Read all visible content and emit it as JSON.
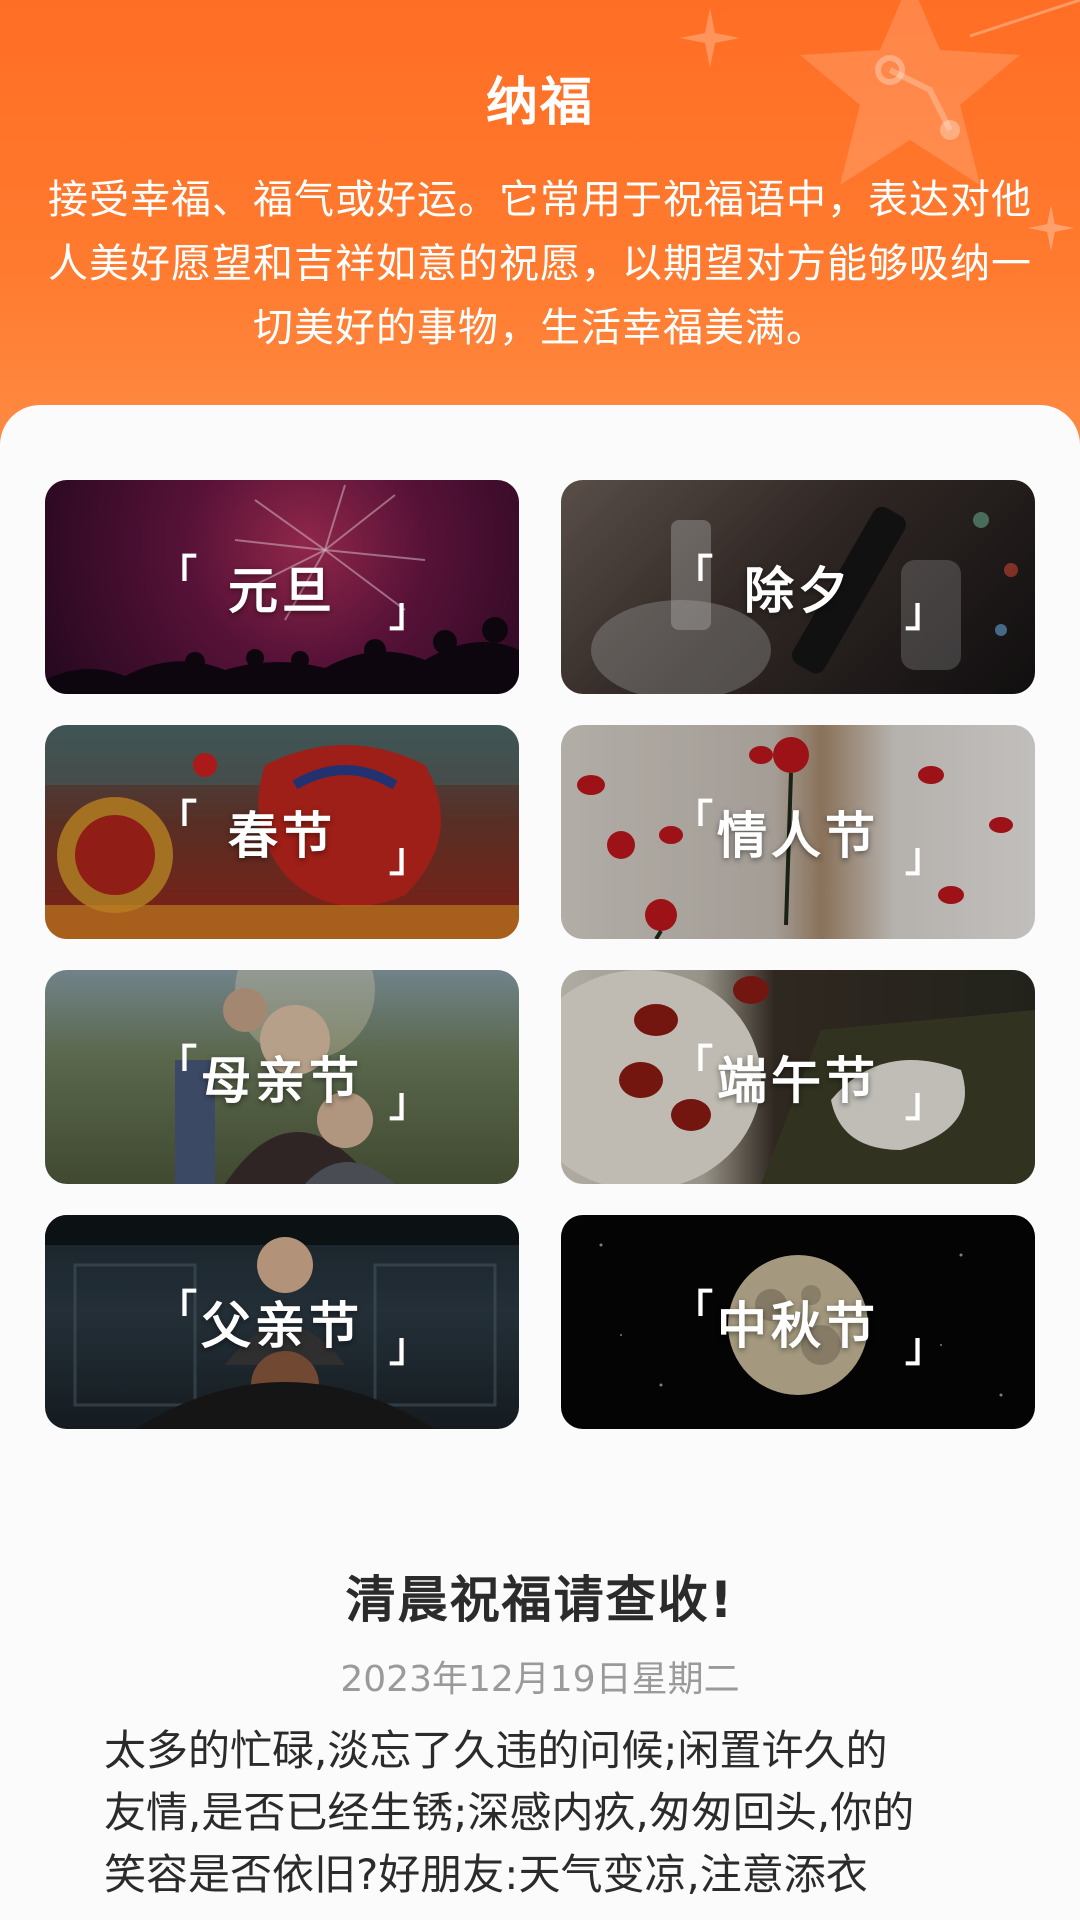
{
  "header": {
    "title": "纳福",
    "description": "接受幸福、福气或好运。它常用于祝福语中，表达对他人美好愿望和吉祥如意的祝愿，以期望对方能够吸纳一切美好的事物，生活幸福美满。"
  },
  "festivals": [
    {
      "label": "元旦"
    },
    {
      "label": "除夕"
    },
    {
      "label": "春节"
    },
    {
      "label": "情人节"
    },
    {
      "label": "母亲节"
    },
    {
      "label": "端午节"
    },
    {
      "label": "父亲节"
    },
    {
      "label": "中秋节"
    }
  ],
  "card_bracket": {
    "open": "「",
    "close": "」"
  },
  "article": {
    "title": "清晨祝福请查收!",
    "date": "2023年12月19日星期二",
    "lines": [
      "太多的忙碌,淡忘了久违的问候;闲置许久的",
      "友情,是否已经生锈;深感内疚,匆匆回头,你的",
      "笑容是否依旧?好朋友:天气变凉,注意添衣"
    ]
  },
  "colors": {
    "header_orange": "#ff6e24",
    "background": "#fbfbfb",
    "title_text": "#2b2b2b",
    "date_text": "#9a9a9a"
  }
}
